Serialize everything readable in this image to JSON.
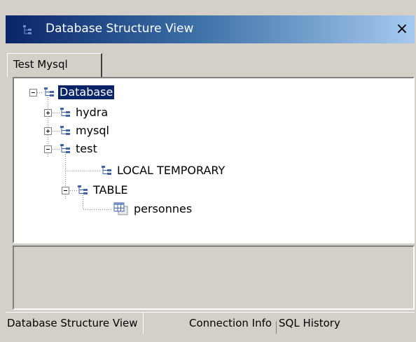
{
  "window": {
    "title": "Database Structure View",
    "close_label": "×"
  },
  "top_tabs": [
    {
      "label": "Test Mysql",
      "active": true
    }
  ],
  "tree": {
    "root": {
      "label": "Database",
      "selected": true,
      "expanded": true,
      "icon": "schema-icon"
    },
    "nodes": [
      {
        "label": "hydra",
        "expanded": false,
        "icon": "schema-icon"
      },
      {
        "label": "mysql",
        "expanded": false,
        "icon": "schema-icon"
      },
      {
        "label": "test",
        "expanded": true,
        "icon": "schema-icon"
      },
      {
        "label": "LOCAL TEMPORARY",
        "icon": "schema-icon"
      },
      {
        "label": "TABLE",
        "expanded": true,
        "icon": "schema-icon"
      },
      {
        "label": "personnes",
        "icon": "table-icon"
      }
    ]
  },
  "bottom_tabs": [
    {
      "label": "Database Structure View",
      "active": true
    },
    {
      "label": "Connection Info",
      "active": false
    },
    {
      "label": "SQL History",
      "active": false
    }
  ],
  "colors": {
    "title_gradient_start": "#0a246a",
    "title_gradient_end": "#a6caf0",
    "selection": "#0a246a",
    "window_bg": "#d4d0c8"
  }
}
